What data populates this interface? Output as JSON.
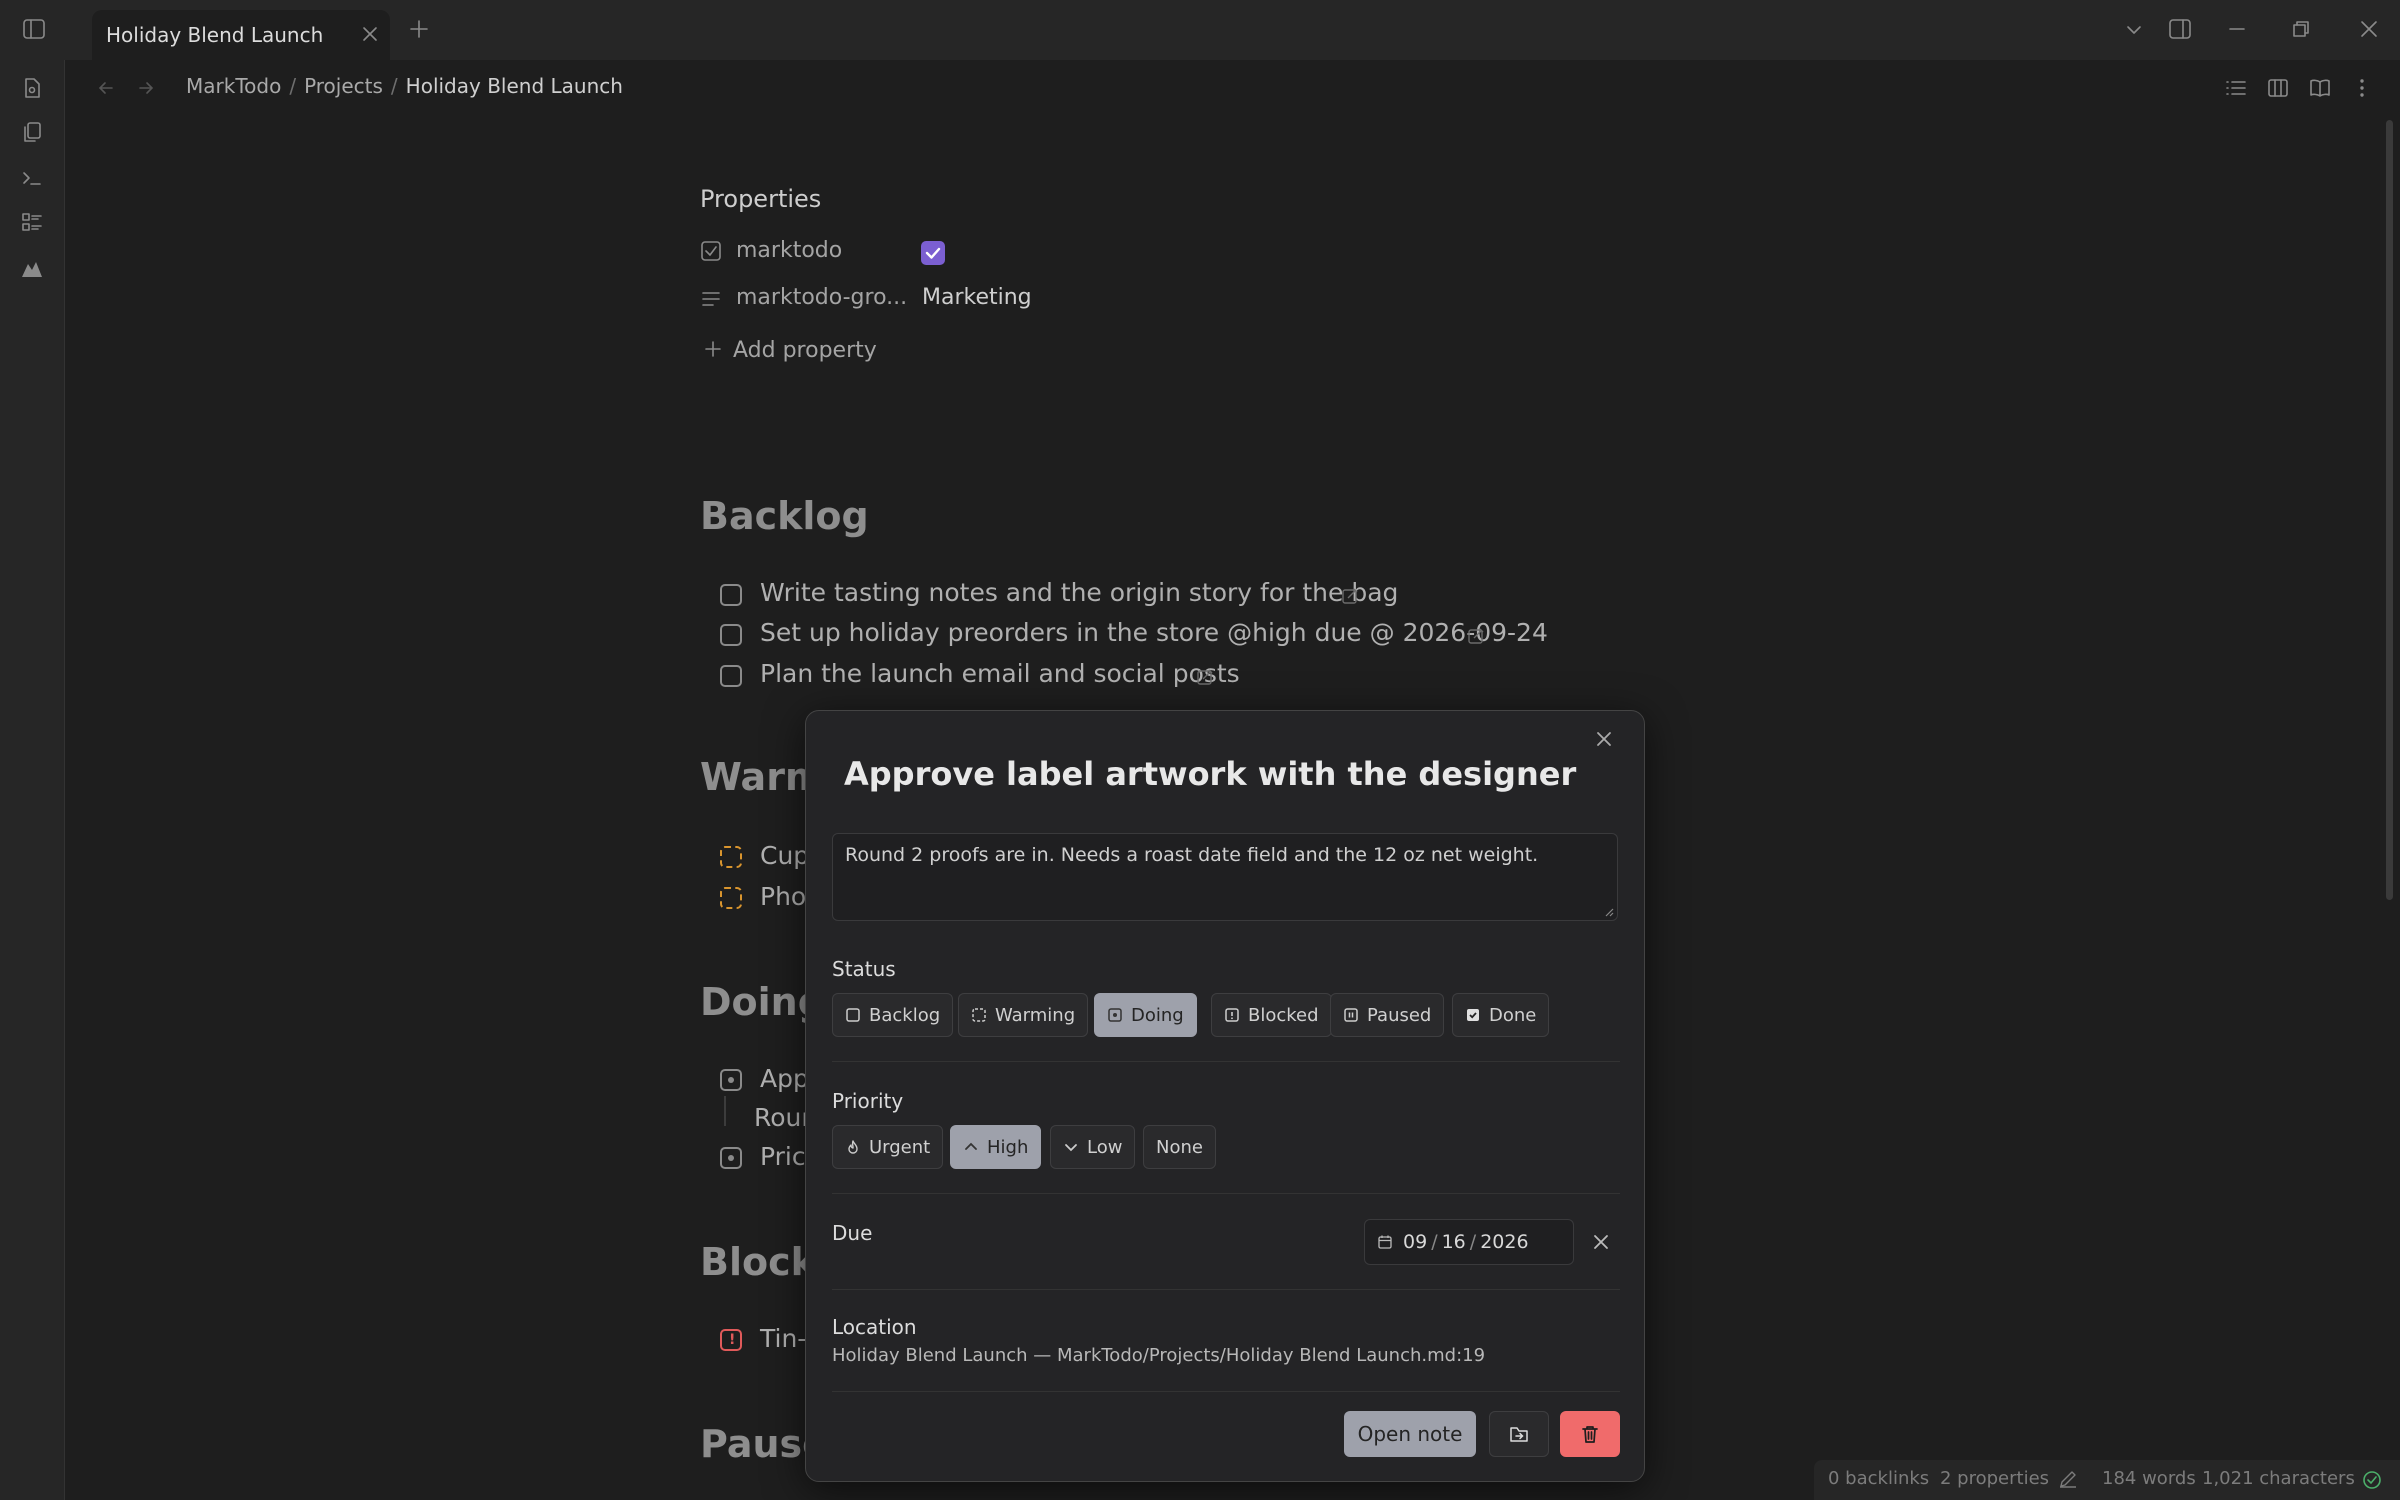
{
  "tab": {
    "title": "Holiday Blend Launch"
  },
  "breadcrumb": {
    "vault": "MarkTodo",
    "folder": "Projects",
    "note": "Holiday Blend Launch",
    "separator": "/"
  },
  "properties": {
    "heading": "Properties",
    "items": [
      {
        "key": "marktodo",
        "value": true,
        "icon": "checkbox-icon"
      },
      {
        "key": "marktodo-gro...",
        "value": "Marketing",
        "icon": "text-lines-icon"
      }
    ],
    "add_label": "Add property"
  },
  "sections": {
    "backlog": {
      "title": "Backlog",
      "tasks": [
        "Write tasting notes and the origin story for the bag",
        "Set up holiday preorders in the store @high due @ 2026-09-24",
        "Plan the launch email and social posts"
      ]
    },
    "warming": {
      "title": "Warm",
      "tasks": [
        "Cup",
        "Pho"
      ]
    },
    "doing": {
      "title": "Doing",
      "tasks": [
        "App",
        "Roun",
        "Pric"
      ]
    },
    "blocked": {
      "title": "Blocke",
      "tasks": [
        "Tin-t"
      ]
    },
    "paused": {
      "title": "Pause"
    }
  },
  "modal": {
    "title": "Approve label artwork with the designer",
    "description": "Round 2 proofs are in. Needs a roast date field and the 12 oz net weight.",
    "status": {
      "label": "Status",
      "options": [
        "Backlog",
        "Warming",
        "Doing",
        "Blocked",
        "Paused",
        "Done"
      ],
      "selected": "Doing"
    },
    "priority": {
      "label": "Priority",
      "options": [
        "Urgent",
        "High",
        "Low",
        "None"
      ],
      "selected": "High"
    },
    "due": {
      "label": "Due",
      "month": "09",
      "day": "16",
      "year": "2026",
      "sep": "/"
    },
    "location": {
      "label": "Location",
      "value": "Holiday Blend Launch — MarkTodo/Projects/Holiday Blend Launch.md:19"
    },
    "buttons": {
      "open_note": "Open note"
    }
  },
  "status_bar": {
    "backlinks": "0 backlinks",
    "properties": "2 properties",
    "words": "184 words",
    "characters": "1,021 characters"
  },
  "colors": {
    "accent_purple": "#7b5fd1",
    "warming_orange": "#d9952e",
    "blocked_red": "#e05a5a",
    "delete_red": "#f06b6b",
    "active_chip": "#9ea1ab"
  }
}
